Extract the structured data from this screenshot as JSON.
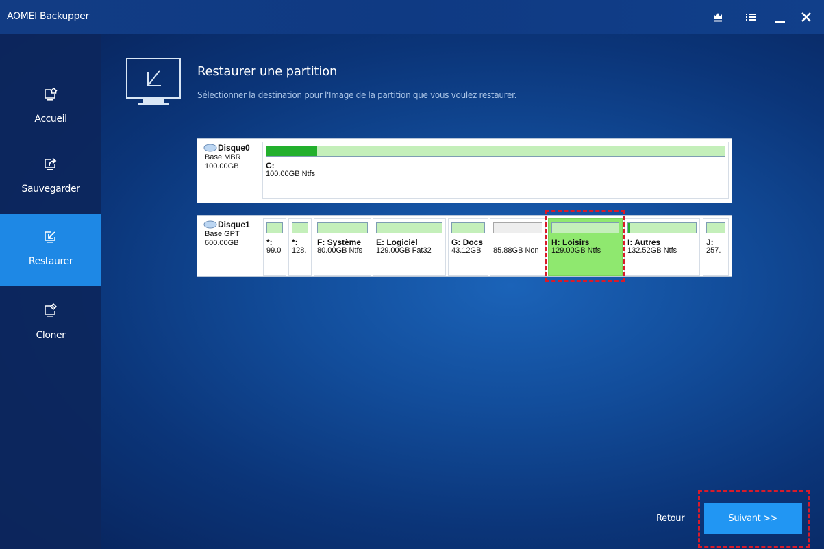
{
  "app": {
    "title": "AOMEI Backupper"
  },
  "titlebar": {
    "icons": [
      "crown-icon",
      "menu-icon",
      "minimize-icon",
      "close-icon"
    ]
  },
  "sidebar": {
    "items": [
      {
        "label": "Accueil",
        "icon": "home-icon",
        "active": false
      },
      {
        "label": "Sauvegarder",
        "icon": "backup-icon",
        "active": false
      },
      {
        "label": "Restaurer",
        "icon": "restore-icon",
        "active": true
      },
      {
        "label": "Cloner",
        "icon": "clone-icon",
        "active": false
      }
    ]
  },
  "header": {
    "title": "Restaurer une partition",
    "subtitle": "Sélectionner la destination pour l'Image de la partition que vous voulez restaurer."
  },
  "disks": [
    {
      "name": "Disque0",
      "type": "Base MBR",
      "size": "100.00GB",
      "partitions": [
        {
          "label": "C:",
          "info": "100.00GB Ntfs",
          "used_fraction": 0.11
        }
      ]
    },
    {
      "name": "Disque1",
      "type": "Base GPT",
      "size": "600.00GB",
      "partitions": [
        {
          "label": "*:",
          "info": "99.0",
          "used_fraction": 0
        },
        {
          "label": "*:",
          "info": "128.",
          "used_fraction": 0
        },
        {
          "label": "F: Système",
          "info": "80.00GB Ntfs",
          "used_fraction": 0
        },
        {
          "label": "E: Logiciel",
          "info": "129.00GB Fat32",
          "used_fraction": 0
        },
        {
          "label": "G: Docs",
          "info": "43.12GB",
          "used_fraction": 0
        },
        {
          "label": "",
          "info": "85.88GB Non",
          "used_fraction": 0,
          "unallocated": true
        },
        {
          "label": "H: Loisirs",
          "info": "129.00GB Ntfs",
          "used_fraction": 0,
          "selected": true
        },
        {
          "label": "I: Autres",
          "info": "132.52GB Ntfs",
          "used_fraction": 0.03
        },
        {
          "label": "J:",
          "info": "257.",
          "used_fraction": 0
        }
      ]
    }
  ],
  "footer": {
    "back_label": "Retour",
    "next_label": "Suivant >>"
  },
  "colors": {
    "accent": "#1e88e5",
    "button": "#2196f3",
    "selected_partition": "#8fe86f",
    "used_fill": "#23b02d",
    "highlight_dash": "#d81b2a"
  }
}
